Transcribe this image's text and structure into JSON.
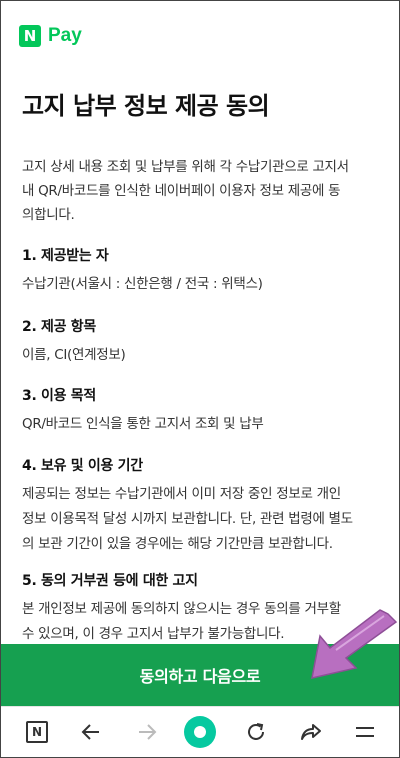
{
  "brand": {
    "logo_letter": "N",
    "name": "Pay"
  },
  "page": {
    "title": "고지 납부 정보 제공 동의",
    "intro_lines": [
      "고지 상세 내용 조회 및 납부를 위해 각 수납기관으로 고지서",
      "내 QR/바코드를 인식한 네이버페이 이용자 정보 제공에 동",
      "의합니다."
    ]
  },
  "sections": [
    {
      "heading": "1. 제공받는 자",
      "lines": [
        "수납기관(서울시 : 신한은행 / 전국 : 위택스)"
      ]
    },
    {
      "heading": "2. 제공 항목",
      "lines": [
        "이름, CI(연계정보)"
      ]
    },
    {
      "heading": "3. 이용 목적",
      "lines": [
        "QR/바코드 인식을 통한 고지서 조회 및 납부"
      ]
    },
    {
      "heading": "4. 보유 및 이용 기간",
      "lines": [
        "제공되는 정보는 수납기관에서 이미 저장 중인 정보로 개인",
        "정보 이용목적 달성 시까지 보관합니다. 단, 관련 법령에 별도",
        "의 보관 기간이 있을 경우에는 해당 기간만큼 보관합니다."
      ]
    },
    {
      "heading": "5. 동의 거부권 등에 대한 고지",
      "lines": [
        "본 개인정보 제공에 동의하지 않으시는 경우 동의를 거부할",
        "수 있으며, 이 경우 고지서 납부가 불가능합니다."
      ]
    }
  ],
  "cta": {
    "label": "동의하고 다음으로"
  },
  "toolbar": {
    "home_letter": "N",
    "icons": [
      "naver-home-icon",
      "back-arrow-icon",
      "forward-arrow-icon",
      "green-dot-icon",
      "refresh-icon",
      "share-icon",
      "menu-icon"
    ]
  },
  "colors": {
    "brand_green": "#03c75a",
    "cta_green": "#16a050",
    "arrow_purple": "#b86fc0"
  }
}
